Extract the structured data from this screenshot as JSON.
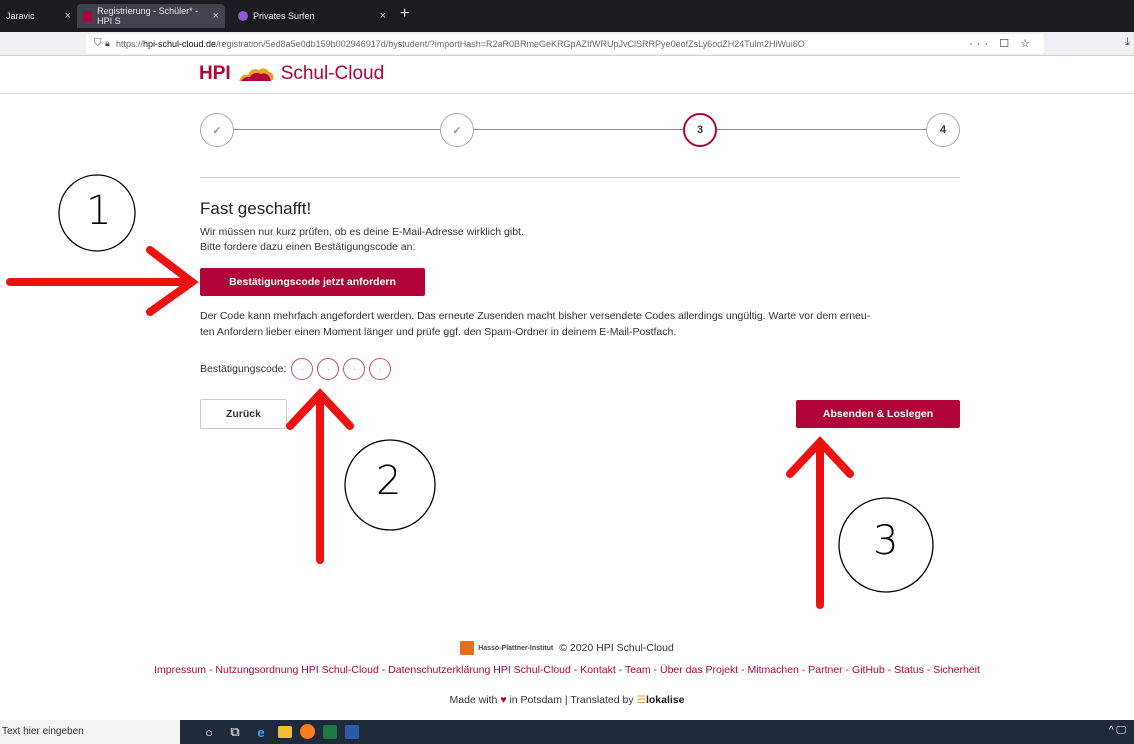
{
  "browser": {
    "tabs": [
      {
        "label": "Jaravic",
        "close": "×"
      },
      {
        "label": "Registrierung - Schüler* - HPI S",
        "close": "×"
      },
      {
        "label": "Privates Surfen",
        "close": "×"
      }
    ],
    "new_tab": "+",
    "url_prefix": "https://",
    "url_host": "hpi-schul-cloud.de",
    "url_path": "/registration/5ed8a5e0db159b002946917d/bystudent/?importHash=R2aR0BRmeGeKRGpAZIfWRUpJvClSRRPye0eofZsLy6odZH24Tulm2HiWui6O",
    "url_actions": "··· ☐ ☆",
    "download": "⤓"
  },
  "header": {
    "logo_hpi": "HPI",
    "logo_sc": "Schul-Cloud"
  },
  "stepper": {
    "steps": [
      {
        "label": "✓",
        "state": "done"
      },
      {
        "label": "✓",
        "state": "done"
      },
      {
        "label": "3",
        "state": "active"
      },
      {
        "label": "4",
        "state": "pending"
      }
    ]
  },
  "content": {
    "title": "Fast geschafft!",
    "intro_line1": "Wir müssen nur kurz prüfen, ob es deine E-Mail-Adresse wirklich gibt.",
    "intro_line2": "Bitte fordere dazu einen Bestätigungscode an:",
    "request_button": "Bestätigungscode jetzt anfordern",
    "info_line1": "Der Code kann mehrfach angefordert werden. Das erneute Zusenden macht bisher versendete Codes allerdings ungültig. Warte vor dem erneu-",
    "info_line2": "ten Anfordern lieber einen Moment länger und prüfe ggf. den Spam-Ordner in deinem E-Mail-Postfach.",
    "code_label": "Bestätigungscode:",
    "code_placeholder": "·",
    "back_button": "Zurück",
    "submit_button": "Absenden & Loslegen"
  },
  "annotations": {
    "one": "1",
    "two": "2",
    "three": "3",
    "arrow_color": "#ee1111"
  },
  "footer": {
    "hpi_name": "Hasso-Plattner-Institut",
    "copyright": "© 2020 HPI Schul-Cloud",
    "links": [
      "Impressum",
      "Nutzungsordnung HPI Schul-Cloud",
      "Datenschutzerklärung HPI Schul-Cloud",
      "Kontakt",
      "Team",
      "Über das Projekt",
      "Mitmachen",
      "Partner",
      "GitHub",
      "Status",
      "Sicherheit"
    ],
    "made_with": "Made with",
    "heart": "♥",
    "in_potsdam": "in Potsdam | Translated by",
    "lokalise_icon": "☰",
    "lokalise": "lokalise"
  },
  "taskbar": {
    "search_placeholder": "Text hier eingeben",
    "tray": "^ 🖵"
  },
  "colors": {
    "brand": "#b10438",
    "done": "#3a9a3a"
  }
}
